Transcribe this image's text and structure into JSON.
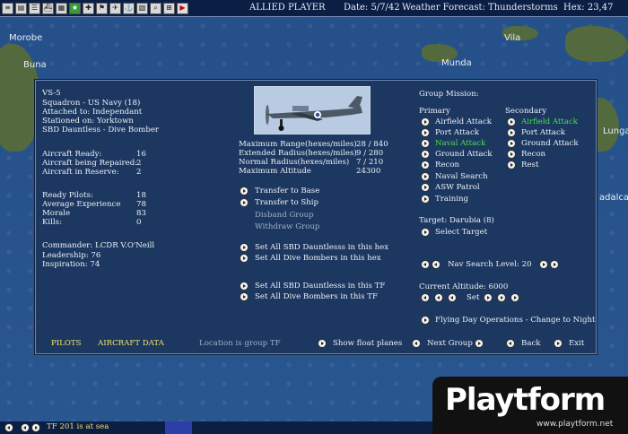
{
  "topbar": {
    "player": "ALLIED PLAYER",
    "date": "Date: 5/7/42",
    "weather": "Weather Forecast: Thunderstorms",
    "hex": "Hex: 23,47"
  },
  "map": {
    "labels": [
      "Morobe",
      "Buna",
      "Vila",
      "Munda",
      "Lunga",
      "adalca"
    ]
  },
  "squadron": {
    "name": "VS-5",
    "type": "Squadron - US Navy (18)",
    "attached": "Attached to: Independant",
    "stationed": "Stationed on: Yorktown",
    "aircraft": "SBD Dauntless - Dive Bomber"
  },
  "stats": [
    {
      "label": "Aircraft Ready:",
      "value": "16"
    },
    {
      "label": "Aircraft being Repaired:",
      "value": "2"
    },
    {
      "label": "Aircraft in Reserve:",
      "value": "2"
    }
  ],
  "pilots": [
    {
      "label": "Ready Pilots:",
      "value": "18"
    },
    {
      "label": "Average Experience",
      "value": "78"
    },
    {
      "label": "Morale",
      "value": "83"
    },
    {
      "label": "Kills:",
      "value": "0"
    }
  ],
  "commander": {
    "name": "Commander:  LCDR V.O'Neill",
    "leadership": "Leadership:  76",
    "inspiration": "Inspiration:  74"
  },
  "ranges": [
    {
      "label": "Maximum Range(hexes/miles)",
      "value": "28 / 840"
    },
    {
      "label": "Extended Radius(hexes/miles)",
      "value": "9 / 280"
    },
    {
      "label": "Normal Radius(hexes/miles)",
      "value": "7 / 210"
    },
    {
      "label": "Maximum Altitude",
      "value": "24300"
    }
  ],
  "actions": {
    "transfer_base": "Transfer to Base",
    "transfer_ship": "Transfer to Ship",
    "disband": "Disband Group",
    "withdraw": "Withdraw Group",
    "set_hex_type": "Set All SBD Dauntlesss in this hex",
    "set_hex_role": "Set All Dive Bombers in this hex",
    "set_tf_type": "Set All SBD Dauntlesss in this TF",
    "set_tf_role": "Set All Dive Bombers in this TF"
  },
  "mission": {
    "title": "Group Mission:",
    "primary_title": "Primary",
    "secondary_title": "Secondary",
    "primary": [
      "Airfield Attack",
      "Port Attack",
      "Naval Attack",
      "Ground Attack",
      "Recon",
      "Naval Search",
      "ASW Patrol",
      "Training"
    ],
    "secondary": [
      "Airfield Attack",
      "Port Attack",
      "Ground Attack",
      "Recon",
      "Rest"
    ],
    "target": "Target:  Darubia  (8)",
    "select_target": "Select Target",
    "nav_search": "Nav Search Level:  20",
    "altitude": "Current Altitude:  6000",
    "set": "Set",
    "flying_day": "Flying Day Operations - Change to Night"
  },
  "footer": {
    "pilots": "PILOTS",
    "aircraft_data": "AIRCRAFT DATA",
    "location": "Location is group TF",
    "show_float": "Show float planes",
    "next_group": "Next Group",
    "back": "Back",
    "exit": "Exit"
  },
  "bottombar": {
    "tf_text": "TF 201 is at sea"
  },
  "watermark": {
    "logo": "Playtform",
    "url": "www.playtform.net"
  },
  "colors": {
    "highlight_green": "#4ce04c",
    "footer_yellow": "#f3e36e",
    "panel_bg": "#1c3760"
  }
}
